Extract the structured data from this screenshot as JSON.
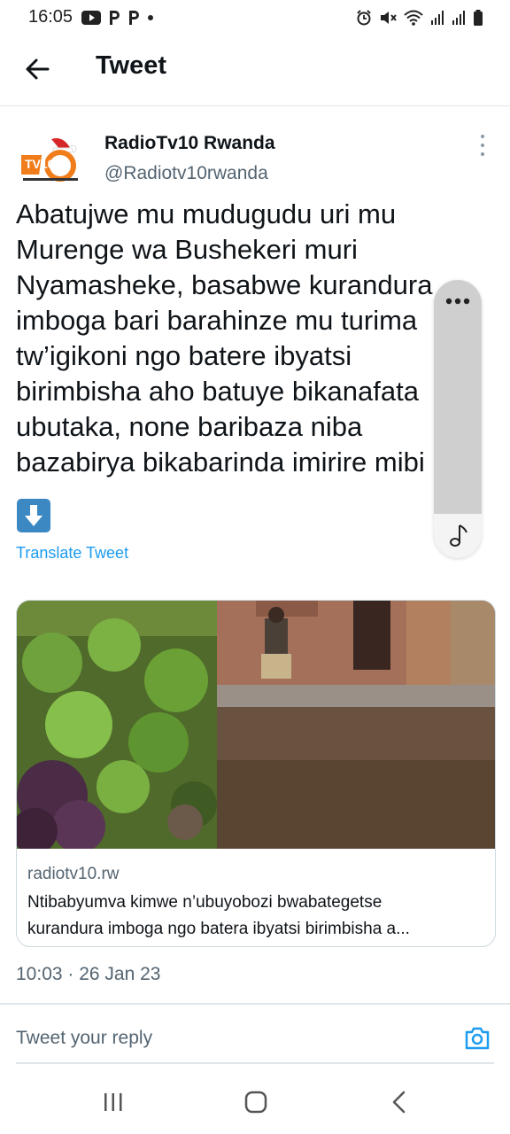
{
  "status_bar": {
    "time": "16:05",
    "left_icons": [
      "youtube-icon",
      "p-icon",
      "p-icon",
      "dot-icon"
    ],
    "right_icons": [
      "alarm-icon",
      "mute-icon",
      "wifi-icon",
      "signal-icon",
      "signal-icon",
      "battery-icon"
    ]
  },
  "header": {
    "title": "Tweet"
  },
  "tweet": {
    "author_name": "RadioTv10 Rwanda",
    "author_handle": "@Radiotv10rwanda",
    "avatar_text": "TV10",
    "text_lines": [
      "Abatujwe mu mudugudu uri mu",
      "Murenge wa Bushekeri muri",
      "Nyamasheke, basabwe kurandura",
      "imboga bari barahinze mu turima",
      "tw’igikoni ngo batere ibyatsi",
      "birimbisha aho batuye bikanafata",
      "ubutaka, none baribaza niba",
      "bazabirya bikabarinda imirire mibi"
    ],
    "emoji": "⬇️",
    "translate_label": "Translate Tweet",
    "link_card": {
      "domain": "radiotv10.rw",
      "title_lines": [
        "Ntibabyumva kimwe n’ubuyobozi bwabategetse",
        "kurandura imboga ngo batera ibyatsi birimbisha a..."
      ]
    },
    "timestamp": "10:03 · 26 Jan 23"
  },
  "reply": {
    "placeholder": "Tweet your reply"
  },
  "floating_pill": {
    "top_icon": "more-icon",
    "bottom_icon": "music-note-icon"
  },
  "nav_bar": {
    "items": [
      "recents-icon",
      "home-icon",
      "back-icon"
    ]
  },
  "colors": {
    "accent": "#1d9bf0",
    "text": "#0f1419",
    "secondary": "#536471"
  }
}
